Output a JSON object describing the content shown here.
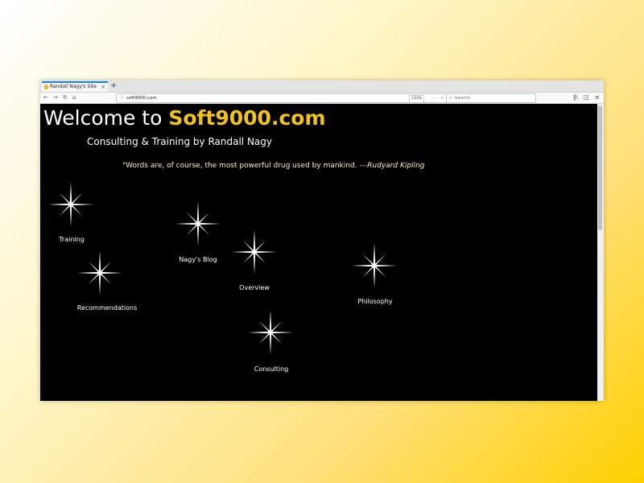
{
  "browser": {
    "tab_title": "Randall Nagy's Site",
    "tab_close": "×",
    "new_tab": "+",
    "url": "soft9000.com",
    "zoom": "133%",
    "search_placeholder": "Search",
    "url_info_icon": "ⓘ",
    "page_actions": "···",
    "bookmark_star": "☆",
    "search_glyph": "⌕",
    "icons": [
      "back-icon",
      "forward-icon",
      "reload-icon",
      "home-icon",
      "library-icon",
      "sidebar-icon",
      "menu-icon"
    ]
  },
  "page": {
    "welcome_prefix": "Welcome to ",
    "brand": "Soft9000.com",
    "brand_color": "#f2c21d",
    "subtitle": "Consulting & Training by Randall Nagy",
    "quote_text": "\"Words are, of course, the most powerful drug used by mankind.  ",
    "quote_author": "---Rudyard Kipling",
    "links": {
      "training": "Training",
      "blog": "Nagy's Blog",
      "recommendations": "Recommendations",
      "overview": "Overview",
      "philosophy": "Philosophy",
      "consulting": "Consulting"
    }
  }
}
